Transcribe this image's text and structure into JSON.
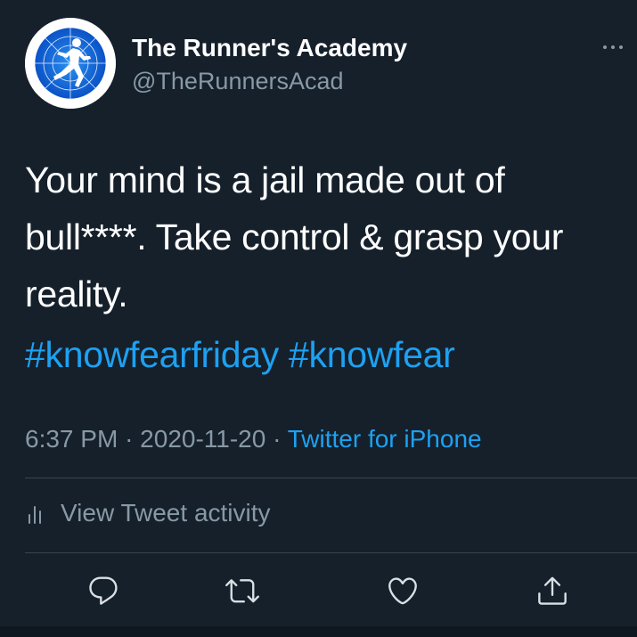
{
  "author": {
    "name": "The Runner's Academy",
    "handle": "@TheRunnersAcad",
    "avatar_icon": "runner-logo-icon"
  },
  "tweet": {
    "text": "Your mind is a jail made out of bull****. Take control & grasp your reality.",
    "hashtags": [
      "#knowfearfriday",
      "#knowfear"
    ]
  },
  "meta": {
    "time": "6:37 PM",
    "separator": "·",
    "date": "2020-11-20",
    "source": "Twitter for iPhone"
  },
  "activity": {
    "label": "View Tweet activity",
    "icon": "analytics-icon"
  },
  "actions": [
    {
      "name": "reply",
      "icon": "reply-icon"
    },
    {
      "name": "retweet",
      "icon": "retweet-icon"
    },
    {
      "name": "like",
      "icon": "heart-icon"
    },
    {
      "name": "share",
      "icon": "share-icon"
    }
  ],
  "colors": {
    "background": "#15202b",
    "text_primary": "#ffffff",
    "text_secondary": "#8899a6",
    "accent": "#1da1f2",
    "divider": "#38444d"
  }
}
